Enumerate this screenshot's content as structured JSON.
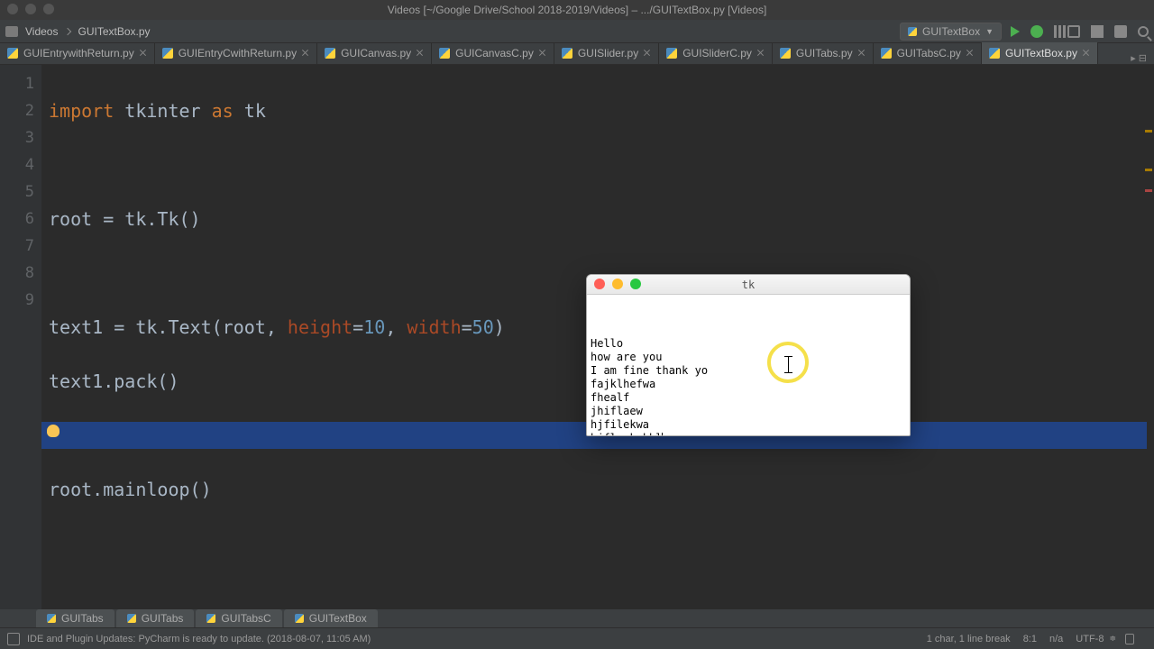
{
  "mac_title": "Videos [~/Google Drive/School 2018-2019/Videos] – .../GUITextBox.py [Videos]",
  "breadcrumb": {
    "folder": "Videos",
    "file": "GUITextBox.py"
  },
  "run_config": {
    "name": "GUITextBox"
  },
  "tabs": [
    {
      "label": "GUIEntrywithReturn.py",
      "active": false
    },
    {
      "label": "GUIEntryCwithReturn.py",
      "active": false
    },
    {
      "label": "GUICanvas.py",
      "active": false
    },
    {
      "label": "GUICanvasC.py",
      "active": false
    },
    {
      "label": "GUISlider.py",
      "active": false
    },
    {
      "label": "GUISliderC.py",
      "active": false
    },
    {
      "label": "GUITabs.py",
      "active": false
    },
    {
      "label": "GUITabsC.py",
      "active": false
    },
    {
      "label": "GUITextBox.py",
      "active": true
    }
  ],
  "tabs_overflow": "▸ ⊟",
  "code": {
    "line_numbers": [
      "1",
      "2",
      "3",
      "4",
      "5",
      "6",
      "7",
      "8",
      "9"
    ],
    "l1_kw1": "import",
    "l1_name": "tkinter",
    "l1_kw2": "as",
    "l1_alias": "tk",
    "l3": "root = tk.Tk()",
    "l5_a": "text1 = tk.Text(root",
    "l5_comma1": ", ",
    "l5_kwarg1": "height",
    "l5_eq1": "=",
    "l5_num1": "10",
    "l5_comma2": ", ",
    "l5_kwarg2": "width",
    "l5_eq2": "=",
    "l5_num2": "50",
    "l5_close": ")",
    "l6": "text1.pack()",
    "l8": "root.mainloop()"
  },
  "tk_window": {
    "title": "tk",
    "text_lines": [
      "Hello",
      "how are you",
      "I am fine thank yo",
      "",
      "",
      "fajklhefwa",
      "fhealf",
      "jhiflaew",
      "hjfilekwa",
      "hjfleakwkhl"
    ]
  },
  "run_tabs": [
    "GUITabs",
    "GUITabs",
    "GUITabsC",
    "GUITextBox"
  ],
  "status": {
    "message": "IDE and Plugin Updates: PyCharm is ready to update. (2018-08-07, 11:05 AM)",
    "chars": "1 char, 1 line break",
    "pos": "8:1",
    "insert": "n/a",
    "encoding": "UTF-8",
    "indent": ""
  }
}
